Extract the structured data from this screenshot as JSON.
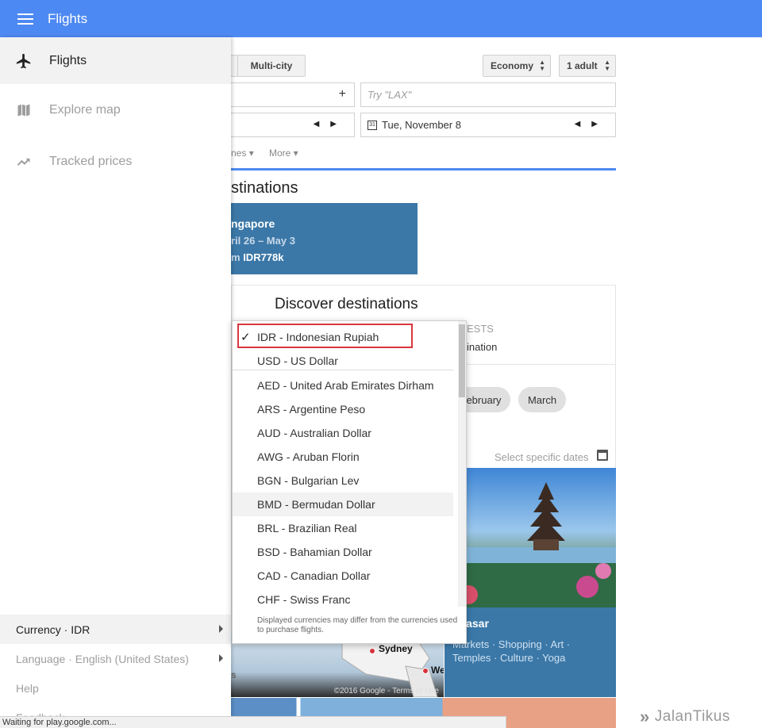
{
  "appbar": {
    "title": "Flights"
  },
  "search": {
    "multicity_label": "Multi-city",
    "cabin_label": "Economy",
    "passengers_label": "1 adult",
    "destination_placeholder": "Try \"LAX\"",
    "return_date": "Tue, November 8",
    "filter_partial": "nes",
    "more_label": "More"
  },
  "promo": {
    "heading_partial": "stinations",
    "city_partial": "ngapore",
    "dates_partial": "ril 26 – May 3",
    "price_prefix_partial": "m",
    "price": "IDR778k"
  },
  "discover": {
    "title": "Discover destinations",
    "interests_partial": "ESTS",
    "destination_partial": "ination",
    "month_partial": "ebruary",
    "month_march": "March",
    "select_dates": "Select specific dates",
    "photo_city_partial": "npasar",
    "photo_tags_line1": "Markets · Shopping · Art ·",
    "photo_tags_line2": "Temples · Culture · Yoga",
    "map_label_sydney": "Sydney",
    "map_label_we": "We",
    "map_label_s": "s",
    "map_copyright": "©2016 Google -",
    "map_terms": "Terms of Use"
  },
  "drawer": {
    "items": [
      {
        "label": "Flights",
        "icon": "airplane-icon"
      },
      {
        "label": "Explore map",
        "icon": "map-icon"
      },
      {
        "label": "Tracked prices",
        "icon": "trending-up-icon"
      }
    ],
    "bottom": {
      "currency": "Currency · IDR",
      "language": "Language · English (United States)",
      "help": "Help",
      "feedback": "Feedback"
    }
  },
  "currency_menu": {
    "options": [
      {
        "label": "IDR - Indonesian Rupiah",
        "selected": true
      },
      {
        "label": "USD - US Dollar"
      },
      {
        "label": "AED - United Arab Emirates Dirham"
      },
      {
        "label": "ARS - Argentine Peso"
      },
      {
        "label": "AUD - Australian Dollar"
      },
      {
        "label": "AWG - Aruban Florin"
      },
      {
        "label": "BGN - Bulgarian Lev"
      },
      {
        "label": "BMD - Bermudan Dollar",
        "hovered": true
      },
      {
        "label": "BRL - Brazilian Real"
      },
      {
        "label": "BSD - Bahamian Dollar"
      },
      {
        "label": "CAD - Canadian Dollar"
      },
      {
        "label": "CHF - Swiss Franc"
      }
    ],
    "note": "Displayed currencies may differ from the currencies used to purchase flights."
  },
  "status_bar": {
    "text": "Waiting for play.google.com..."
  },
  "watermark": {
    "text": "JalanTikus"
  },
  "colors": {
    "appbar": "#4d89f2",
    "card_blue": "#3b78a8",
    "highlight_box": "#d9363e"
  }
}
